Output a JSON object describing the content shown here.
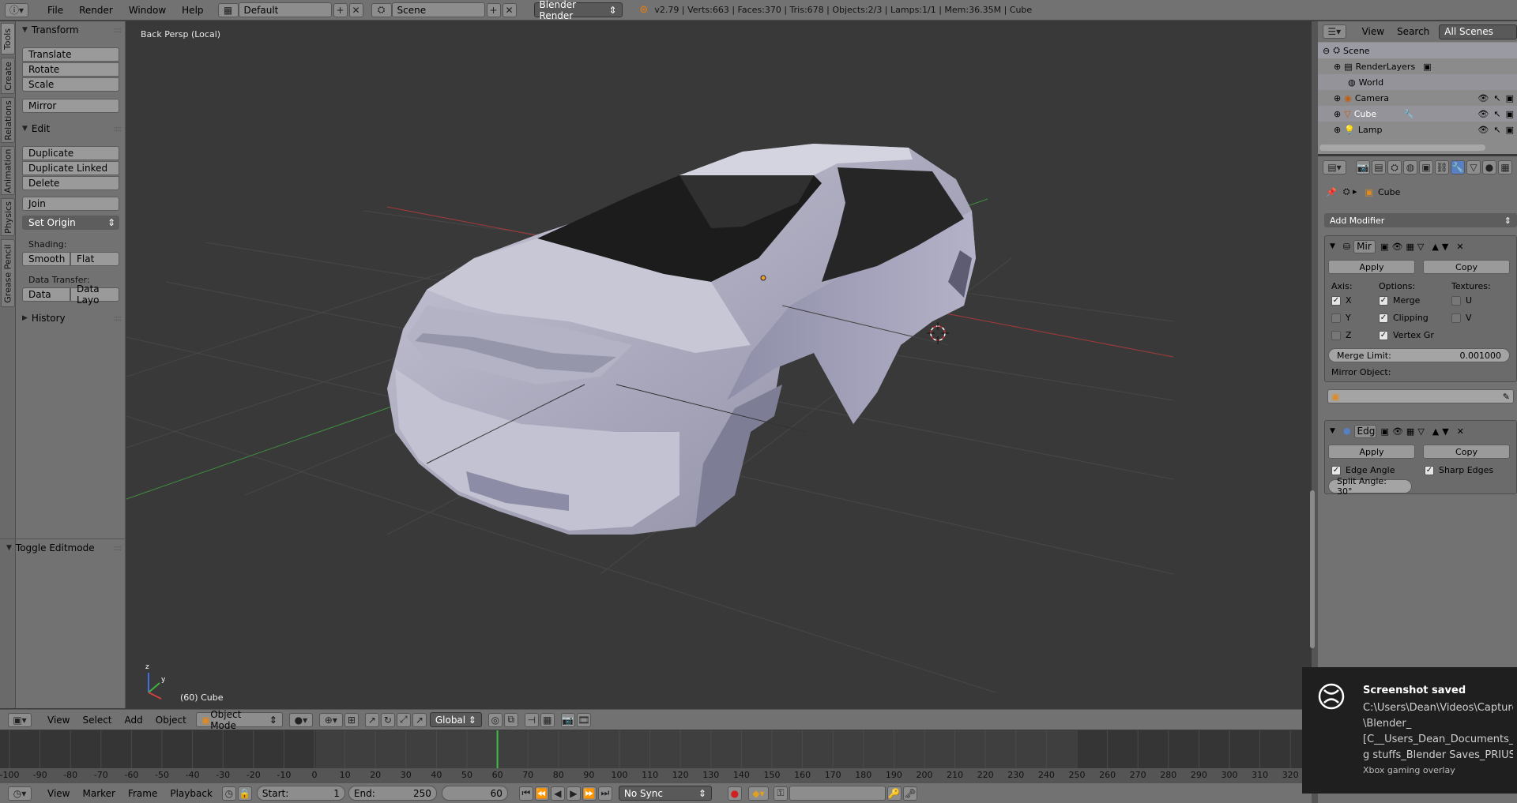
{
  "topbar": {
    "menus": [
      "File",
      "Render",
      "Window",
      "Help"
    ],
    "layout": "Default",
    "scene": "Scene",
    "engine": "Blender Render",
    "stats": "v2.79 | Verts:663 | Faces:370 | Tris:678 | Objects:2/3 | Lamps:1/1 | Mem:36.35M | Cube"
  },
  "tabs": [
    "Tools",
    "Create",
    "Relations",
    "Animation",
    "Physics",
    "Grease Pencil"
  ],
  "toolshelf": {
    "transform_title": "Transform",
    "translate": "Translate",
    "rotate": "Rotate",
    "scale": "Scale",
    "mirror": "Mirror",
    "edit_title": "Edit",
    "duplicate": "Duplicate",
    "duplicate_linked": "Duplicate Linked",
    "delete": "Delete",
    "join": "Join",
    "set_origin": "Set Origin",
    "shading_label": "Shading:",
    "smooth": "Smooth",
    "flat": "Flat",
    "data_transfer_label": "Data Transfer:",
    "data": "Data",
    "data_layout": "Data Layo",
    "history_title": "History",
    "toggle_editmode": "Toggle Editmode"
  },
  "viewport": {
    "title": "Back Persp (Local)",
    "object_label": "(60) Cube"
  },
  "vpheader": {
    "view": "View",
    "select": "Select",
    "add": "Add",
    "object": "Object",
    "mode": "Object Mode",
    "orientation": "Global"
  },
  "timeline": {
    "ticks": [
      "-100",
      "-90",
      "-80",
      "-70",
      "-60",
      "-50",
      "-40",
      "-30",
      "-20",
      "-10",
      "0",
      "10",
      "20",
      "30",
      "40",
      "50",
      "60",
      "70",
      "80",
      "90",
      "100",
      "110",
      "120",
      "130",
      "140",
      "150",
      "160",
      "170",
      "180",
      "190",
      "200",
      "210",
      "220",
      "230",
      "240",
      "250",
      "260",
      "270",
      "280",
      "290",
      "300",
      "310",
      "320"
    ],
    "current_frame": 60,
    "header": {
      "view": "View",
      "marker": "Marker",
      "frame": "Frame",
      "playback": "Playback",
      "start": "Start:",
      "start_value": "1",
      "end": "End:",
      "end_value": "250",
      "current": "60",
      "sync": "No Sync"
    }
  },
  "outliner": {
    "view": "View",
    "search": "Search",
    "filter": "All Scenes",
    "items": [
      "Scene",
      "RenderLayers",
      "World",
      "Camera",
      "Cube",
      "Lamp"
    ]
  },
  "properties": {
    "object_name": "Cube",
    "add_modifier": "Add Modifier",
    "mirror_mod": {
      "name": "Mir",
      "apply": "Apply",
      "copy": "Copy",
      "axis_label": "Axis:",
      "options_label": "Options:",
      "textures_label": "Textures:",
      "x": "X",
      "y": "Y",
      "z": "Z",
      "merge": "Merge",
      "clipping": "Clipping",
      "vertex_groups": "Vertex Gr",
      "u": "U",
      "v": "V",
      "merge_limit_label": "Merge Limit:",
      "merge_limit_value": "0.001000",
      "mirror_object_label": "Mirror Object:"
    },
    "edge_mod": {
      "name": "Edg",
      "apply": "Apply",
      "copy": "Copy",
      "edge_angle": "Edge Angle",
      "sharp_edges": "Sharp Edges",
      "split_angle": "Split Angle: 30°"
    }
  },
  "toast": {
    "title": "Screenshot saved",
    "lines": [
      "C:\\Users\\Dean\\Videos\\Captures",
      "\\Blender_",
      "[C__Users_Dean_Documents_",
      "g stuffs_Blender Saves_PRIUS"
    ],
    "footer": "Xbox gaming overlay"
  }
}
